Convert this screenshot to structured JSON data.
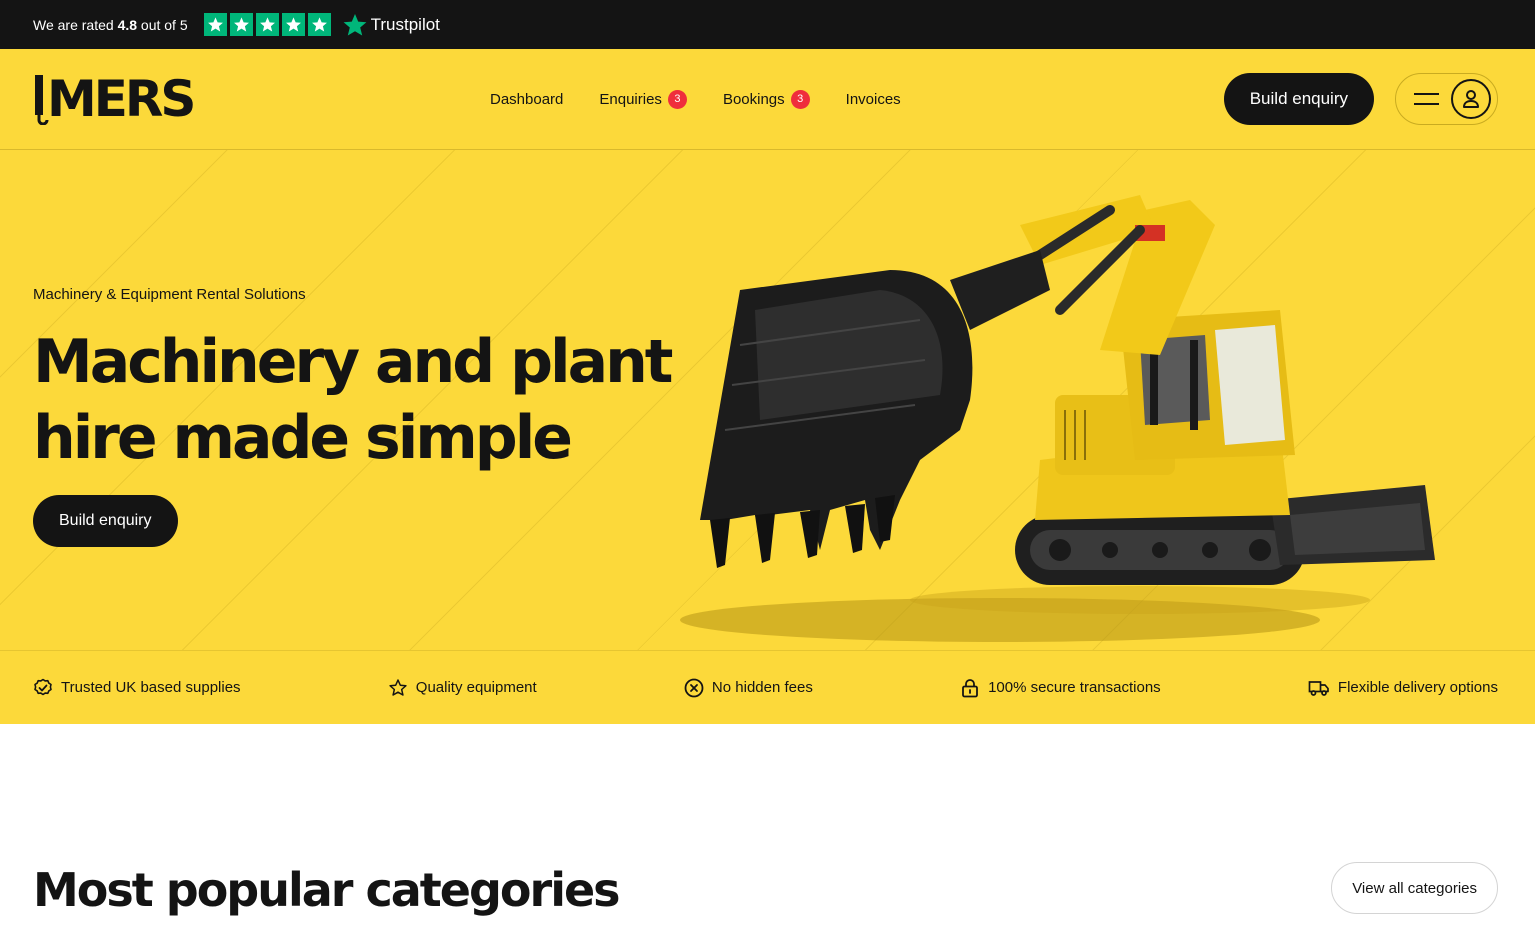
{
  "topbar": {
    "rating_prefix": "We are rated",
    "rating_value": "4.8",
    "rating_suffix": "out of 5",
    "trustpilot_label": "Trustpilot",
    "stars": 5
  },
  "header": {
    "logo_text": "MERS",
    "nav": [
      {
        "label": "Dashboard"
      },
      {
        "label": "Enquiries",
        "badge": "3"
      },
      {
        "label": "Bookings",
        "badge": "3"
      },
      {
        "label": "Invoices"
      }
    ],
    "cta_label": "Build enquiry"
  },
  "hero": {
    "subtitle": "Machinery & Equipment Rental Solutions",
    "title_line1": "Machinery and plant",
    "title_line2": "hire made simple",
    "cta_label": "Build enquiry"
  },
  "features": [
    {
      "icon": "check-circle-icon",
      "label": "Trusted UK based supplies"
    },
    {
      "icon": "star-icon",
      "label": "Quality equipment"
    },
    {
      "icon": "x-circle-icon",
      "label": "No hidden fees"
    },
    {
      "icon": "lock-icon",
      "label": "100% secure transactions"
    },
    {
      "icon": "truck-icon",
      "label": "Flexible delivery options"
    }
  ],
  "categories": {
    "title": "Most popular categories",
    "view_all_label": "View all categories"
  },
  "colors": {
    "brand_yellow": "#fcd93a",
    "dark": "#141414",
    "trustpilot_green": "#00b67a",
    "badge_red": "#ef2d3c"
  }
}
